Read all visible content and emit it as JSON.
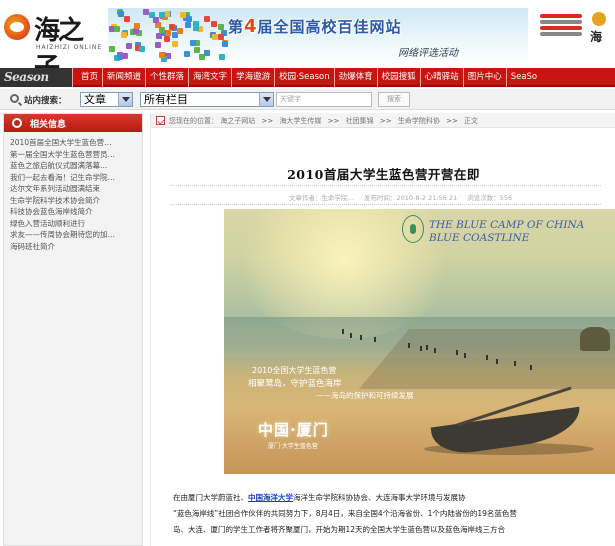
{
  "header": {
    "logo_text": "海之子",
    "logo_sub": "HAIZHIZI ONLINE",
    "banner_title_prefix": "第",
    "banner_title_num": "4",
    "banner_title_suffix": "届全国高校百佳网站",
    "banner_sub": "网络评选活动",
    "corner_char": "海"
  },
  "nav": {
    "logo": "Season",
    "items": [
      "首页",
      "新闻频道",
      "个性群落",
      "海湾文字",
      "学海遨游",
      "校园·Season",
      "劲爆体育",
      "校园搜狐",
      "心晴驿站",
      "图片中心",
      "SeaSo"
    ]
  },
  "search": {
    "label": "站内搜索：",
    "type_select": "文章",
    "column_select": "所有栏目",
    "keyword_placeholder": "关键字",
    "button_label": "搜索"
  },
  "sidebar": {
    "title": "相关信息",
    "items": [
      "2010首届全国大学生蓝色营…",
      "第一届全国大学生蓝色营营员…",
      "蓝色之旅启航仪式圆满落幕…",
      "我们一起去看海！记生命学院…",
      "达尔文年系列活动圆满结束",
      "生命学院科学技术协会简介",
      "科技协会蓝色海岸线简介",
      "绿色入营活动顺利进行",
      "求友——传周协会期待您的加…",
      "海码班社简介"
    ]
  },
  "breadcrumb": {
    "prefix": "您现在的位置：",
    "items": [
      "海之子网站",
      "海大学生传媒",
      "社团集锦",
      "生命学院科协",
      "正文"
    ],
    "separator": ">>"
  },
  "article": {
    "title": "2010首届大学生蓝色营开营在即",
    "author_label": "文章作者：",
    "author": "生命学院…",
    "time_label": "发布时间：",
    "time": "2010-8-2 21:56:21",
    "views_label": "浏览次数：",
    "views": "556",
    "photo": {
      "en_line1": "THE BLUE CAMP OF CHINA",
      "en_line2": "BLUE COASTLINE",
      "cn_line1": "2010全国大学生蓝色营",
      "cn_line2": "相聚鹭岛，守护蓝色海岸",
      "cn_line3": "——海岛的保护和可持续发展",
      "city": "中国·厦门",
      "city_sub": "厦门·大学生蓝色营"
    },
    "para_line1_a": "在由厦门大学蔚蓝社、",
    "para_line1_link": "中国海洋大学",
    "para_line1_b": "海洋生命学院科协协会、大连海事大学环境与发展协",
    "para_line2": "“蓝色海岸线”社团合作伙伴的共同努力下，8月4日，来自全国4个沿海省份、1个内陆省份的19名蓝色营",
    "para_line3": "岛、大连、厦门的学生工作者将齐聚厦门，开始为期12天的全国大学生蓝色营以及蓝色海岸线三方合"
  },
  "colors": {
    "nav_red": "#c9140f",
    "link_blue": "#1b3fc5",
    "photo_title_blue": "#3c5ca8"
  }
}
